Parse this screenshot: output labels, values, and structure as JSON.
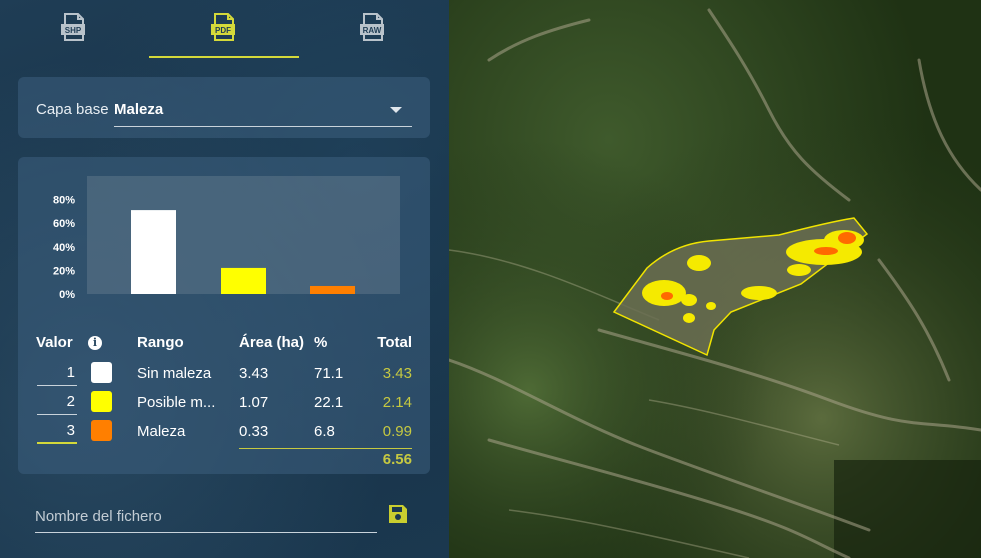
{
  "tabs": [
    {
      "id": "shp",
      "label": "SHP",
      "active": false
    },
    {
      "id": "pdf",
      "label": "PDF",
      "active": true
    },
    {
      "id": "raw",
      "label": "RAW",
      "active": false
    }
  ],
  "colors": {
    "accent": "#d4d93a",
    "total_text": "#c6c941"
  },
  "base_layer": {
    "label": "Capa base",
    "value": "Maleza"
  },
  "chart_data": {
    "type": "bar",
    "categories": [
      "Sin maleza",
      "Posible maleza",
      "Maleza"
    ],
    "values": [
      71.1,
      22.1,
      6.8
    ],
    "colors": [
      "#ffffff",
      "#ffff00",
      "#ff7f00"
    ],
    "yticks": [
      "80%",
      "60%",
      "40%",
      "20%",
      "0%"
    ],
    "ylim": [
      0,
      100
    ],
    "grid": false
  },
  "table": {
    "headers": {
      "valor": "Valor",
      "rango": "Rango",
      "area": "Área (ha)",
      "pct": "%",
      "total": "Total"
    },
    "info_icon": "i",
    "rows": [
      {
        "valor": "1",
        "color": "#ffffff",
        "rango": "Sin maleza",
        "area": "3.43",
        "pct": "71.1",
        "total": "3.43"
      },
      {
        "valor": "2",
        "color": "#ffff00",
        "rango": "Posible m...",
        "area": "1.07",
        "pct": "22.1",
        "total": "2.14"
      },
      {
        "valor": "3",
        "color": "#ff7f00",
        "rango": "Maleza",
        "area": "0.33",
        "pct": "6.8",
        "total": "0.99"
      }
    ],
    "sum": "6.56"
  },
  "filename": {
    "placeholder": "Nombre del fichero"
  },
  "icons": {
    "save": "save-icon",
    "info": "info-icon",
    "dropdown": "caret-down-icon"
  }
}
